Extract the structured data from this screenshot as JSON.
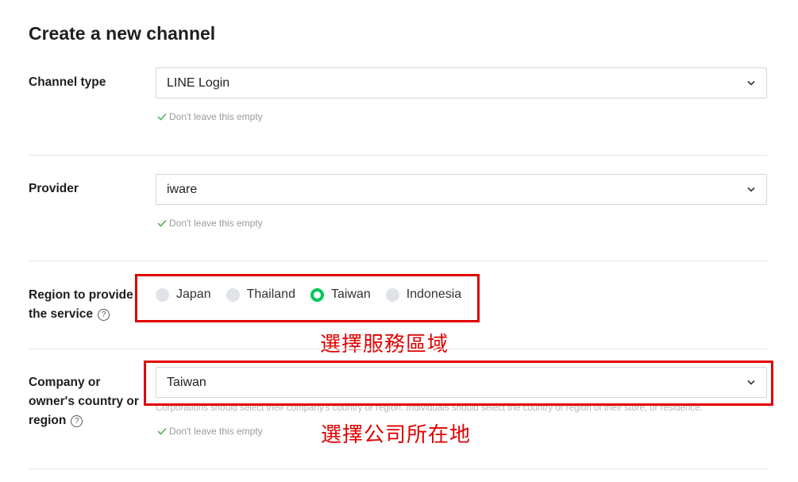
{
  "page": {
    "title": "Create a new channel"
  },
  "channel_type": {
    "label": "Channel type",
    "value": "LINE Login",
    "hint": "Don't leave this empty"
  },
  "provider": {
    "label": "Provider",
    "value": "iware",
    "hint": "Don't leave this empty"
  },
  "region": {
    "label_line1": "Region to provide",
    "label_line2": "the service",
    "help": "?",
    "options": [
      "Japan",
      "Thailand",
      "Taiwan",
      "Indonesia"
    ],
    "selected": "Taiwan",
    "annotation": "選擇服務區域"
  },
  "company_country": {
    "label_line1": "Company or",
    "label_line2": "owner's country or",
    "label_line3": "region",
    "help": "?",
    "value": "Taiwan",
    "description": "Corporations should select their company's country or region. Individuals should select the country or region of their store, or residence.",
    "hint": "Don't leave this empty",
    "annotation": "選擇公司所在地"
  },
  "colors": {
    "accent": "#06c755",
    "annotation": "#e00000",
    "hint": "#9a9a9a",
    "check": "#4caf50"
  }
}
